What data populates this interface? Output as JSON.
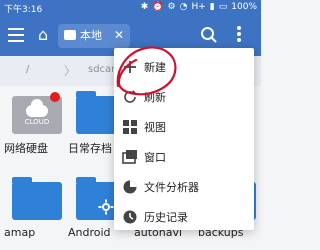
{
  "status": {
    "time": "下午3:16",
    "network": "H+",
    "battery": "100%"
  },
  "appbar": {
    "tab_label": "本地"
  },
  "path": {
    "root": "/",
    "segment": "sdcard"
  },
  "grid": {
    "items": [
      {
        "label": "网络硬盘",
        "cloud_text": "CLOUD"
      },
      {
        "label": "日常存档"
      },
      {
        "label": "amap"
      },
      {
        "label": "Android"
      },
      {
        "label": "autonavi"
      },
      {
        "label": "backups"
      }
    ]
  },
  "menu": {
    "items": [
      {
        "label": "新建",
        "icon": "plus-icon"
      },
      {
        "label": "刷新",
        "icon": "refresh-icon"
      },
      {
        "label": "视图",
        "icon": "grid-view-icon"
      },
      {
        "label": "窗口",
        "icon": "windows-icon"
      },
      {
        "label": "文件分析器",
        "icon": "pie-chart-icon"
      },
      {
        "label": "历史记录",
        "icon": "history-icon"
      }
    ]
  },
  "colors": {
    "primary": "#3d73c2",
    "folder": "#2f81d8",
    "annotation": "#d01030"
  }
}
